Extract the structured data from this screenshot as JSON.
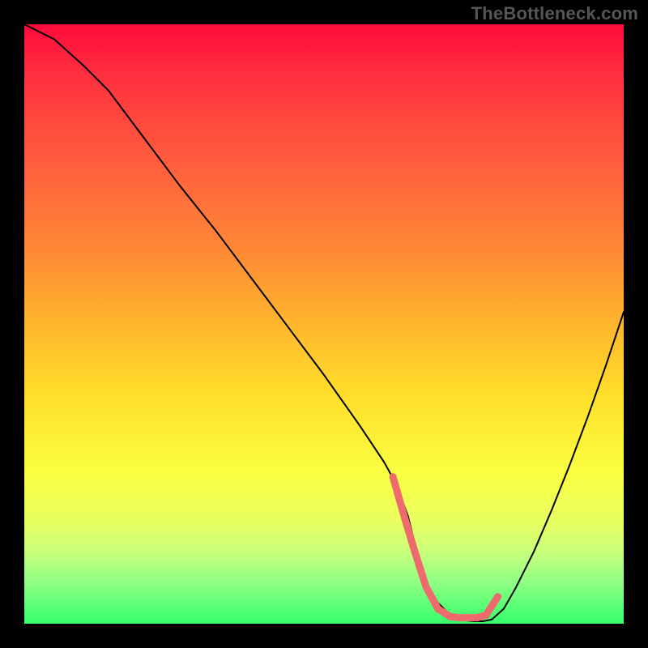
{
  "watermark": "TheBottleneck.com",
  "chart_data": {
    "type": "line",
    "title": "",
    "xlabel": "",
    "ylabel": "",
    "xlim": [
      0,
      100
    ],
    "ylim": [
      0,
      100
    ],
    "grid": false,
    "legend": false,
    "background_gradient": [
      "#ff0a3a",
      "#ffb62e",
      "#faff42",
      "#35ff6c"
    ],
    "series": [
      {
        "name": "curve",
        "color": "#000000",
        "x": [
          0,
          2,
          5,
          10,
          14,
          20,
          26,
          32,
          38,
          44,
          50,
          56,
          60,
          62,
          64,
          65.5,
          67,
          69,
          71,
          73,
          75,
          76.5,
          78,
          80,
          82,
          85,
          88,
          91,
          94,
          97,
          100
        ],
        "y": [
          100,
          99,
          97.5,
          93,
          89,
          81,
          73,
          65.5,
          57.5,
          49.5,
          41.5,
          33,
          27,
          23.4,
          18,
          12,
          7,
          3.5,
          1.5,
          0.6,
          0.4,
          0.4,
          0.7,
          2.5,
          6,
          12,
          19,
          26.5,
          34.5,
          43,
          52
        ]
      },
      {
        "name": "highlight",
        "color": "#ee6a6c",
        "x": [
          61.5,
          63.5,
          65,
          67,
          69,
          71,
          72.5,
          74,
          75.5,
          77,
          79
        ],
        "y": [
          24.5,
          17.5,
          12.5,
          6.2,
          2.5,
          1.2,
          1.0,
          1.0,
          1.0,
          1.4,
          4.5
        ]
      }
    ]
  }
}
